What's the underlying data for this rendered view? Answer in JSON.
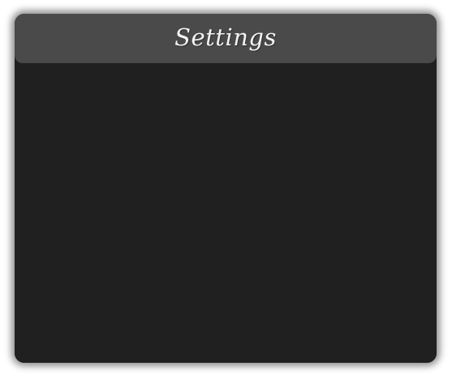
{
  "window": {
    "title": "Settings"
  },
  "colors": {
    "title_bar": "#4a4a4a",
    "panel": "#202020",
    "title_text": "#f4f4f4"
  }
}
